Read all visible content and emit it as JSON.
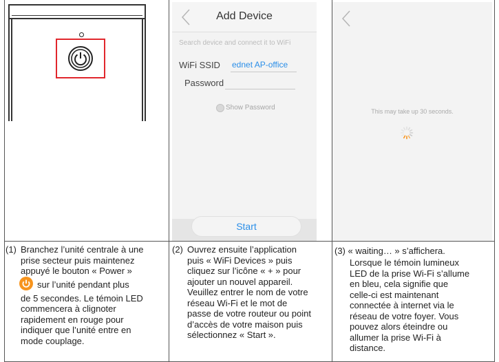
{
  "panel2": {
    "title": "Add Device",
    "hint": "Search device and connect it to WiFi",
    "ssid_label": "WiFi SSID",
    "ssid_value": "ednet AP-office",
    "password_label": "Password",
    "show_password": "Show Password",
    "start_label": "Start"
  },
  "panel3": {
    "wait_text": "This may take up 30 seconds."
  },
  "captions": {
    "c1_num": "(1)",
    "c1_lines": [
      "Branchez l’unité centrale à une",
      "prise secteur puis maintenez",
      "appuyé le bouton « Power »"
    ],
    "c1_after_icon": "sur l’unité pendant plus",
    "c1_lines2": [
      "de 5 secondes. Le témoin LED",
      "commencera à clignoter",
      "rapidement en rouge pour",
      "indiquer que l’unité entre en",
      "mode couplage."
    ],
    "c2_num": "(2)",
    "c2_lines": [
      "Ouvrez ensuite l’application",
      "puis « WiFi Devices » puis",
      "cliquez sur l’icône « + » pour",
      "ajouter un nouvel appareil.",
      "Veuillez entrer le nom de votre",
      "réseau Wi-Fi et le mot de",
      "passe de votre routeur ou point",
      "d’accès de votre maison puis",
      "sélectionnez « Start »."
    ],
    "c3_num": "(3)",
    "c3_first": "« waiting… » s’affichera.",
    "c3_lines": [
      "Lorsque le témoin lumineux",
      "LED de la prise Wi-Fi s’allume",
      "en bleu, cela signifie que",
      "celle-ci est maintenant",
      "connectée à internet via le",
      "réseau de votre foyer. Vous",
      "pouvez alors éteindre ou",
      "allumer la prise Wi-Fi à",
      "distance."
    ]
  },
  "icons": {
    "power_button": "power-icon",
    "back": "chevron-left-icon",
    "loading": "spinner-icon"
  },
  "colors": {
    "highlight_red": "#e1262c",
    "link_blue": "#2a8ee8",
    "power_orange": "#f7941d"
  }
}
